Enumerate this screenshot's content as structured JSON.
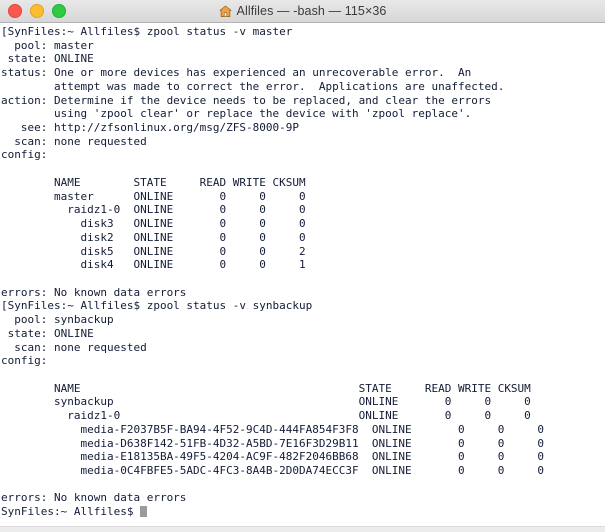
{
  "window": {
    "title": "Allfiles — -bash — 115×36",
    "title_icon": "home-icon",
    "traffic_lights": {
      "close_label": "close",
      "minimize_label": "minimize",
      "maximize_label": "maximize",
      "close_color": "#f9584f",
      "minimize_color": "#fdbc2d",
      "maximize_color": "#2ecb43"
    },
    "colors": {
      "terminal_background": "#ffffff",
      "terminal_text": "#131c37",
      "titlebar_background": "#e0dfdf",
      "cursor": "#9b9b9b"
    }
  },
  "terminal": {
    "columns": 115,
    "rows": 36,
    "prompt": "SynFiles:~ Allfiles$",
    "cursor_visible": true,
    "content": "[SynFiles:~ Allfiles$ zpool status -v master\n  pool: master\n state: ONLINE\nstatus: One or more devices has experienced an unrecoverable error.  An\n        attempt was made to correct the error.  Applications are unaffected.\naction: Determine if the device needs to be replaced, and clear the errors\n        using 'zpool clear' or replace the device with 'zpool replace'.\n   see: http://zfsonlinux.org/msg/ZFS-8000-9P\n  scan: none requested\nconfig:\n\n        NAME        STATE     READ WRITE CKSUM\n        master      ONLINE       0     0     0\n          raidz1-0  ONLINE       0     0     0\n            disk3   ONLINE       0     0     0\n            disk2   ONLINE       0     0     0\n            disk5   ONLINE       0     0     2\n            disk4   ONLINE       0     0     1\n\nerrors: No known data errors\n[SynFiles:~ Allfiles$ zpool status -v synbackup\n  pool: synbackup\n state: ONLINE\n  scan: none requested\nconfig:\n\n        NAME                                          STATE     READ WRITE CKSUM\n        synbackup                                     ONLINE       0     0     0\n          raidz1-0                                    ONLINE       0     0     0\n            media-F2037B5F-BA94-4F52-9C4D-444FA854F3F8  ONLINE       0     0     0\n            media-D638F142-51FB-4D32-A5BD-7E16F3D29B11  ONLINE       0     0     0\n            media-E18135BA-49F5-4204-AC9F-482F2046BB68  ONLINE       0     0     0\n            media-0C4FBFE5-5ADC-4FC3-8A4B-2D0DA74ECC3F  ONLINE       0     0     0\n\nerrors: No known data errors\n",
    "last_line": "SynFiles:~ Allfiles$ ",
    "commands": [
      "zpool status -v master",
      "zpool status -v synbackup"
    ],
    "pools": [
      {
        "pool": "master",
        "state": "ONLINE",
        "status": "One or more devices has experienced an unrecoverable error.  An attempt was made to correct the error.  Applications are unaffected.",
        "action": "Determine if the device needs to be replaced, and clear the errors using 'zpool clear' or replace the device with 'zpool replace'.",
        "see": "http://zfsonlinux.org/msg/ZFS-8000-9P",
        "scan": "none requested",
        "errors": "No known data errors",
        "columns": [
          "NAME",
          "STATE",
          "READ",
          "WRITE",
          "CKSUM"
        ],
        "rows": [
          {
            "name": "master",
            "indent": 0,
            "state": "ONLINE",
            "read": "0",
            "write": "0",
            "cksum": "0"
          },
          {
            "name": "raidz1-0",
            "indent": 1,
            "state": "ONLINE",
            "read": "0",
            "write": "0",
            "cksum": "0"
          },
          {
            "name": "disk3",
            "indent": 2,
            "state": "ONLINE",
            "read": "0",
            "write": "0",
            "cksum": "0"
          },
          {
            "name": "disk2",
            "indent": 2,
            "state": "ONLINE",
            "read": "0",
            "write": "0",
            "cksum": "0"
          },
          {
            "name": "disk5",
            "indent": 2,
            "state": "ONLINE",
            "read": "0",
            "write": "0",
            "cksum": "2"
          },
          {
            "name": "disk4",
            "indent": 2,
            "state": "ONLINE",
            "read": "0",
            "write": "0",
            "cksum": "1"
          }
        ]
      },
      {
        "pool": "synbackup",
        "state": "ONLINE",
        "scan": "none requested",
        "errors": "No known data errors",
        "columns": [
          "NAME",
          "STATE",
          "READ",
          "WRITE",
          "CKSUM"
        ],
        "rows": [
          {
            "name": "synbackup",
            "indent": 0,
            "state": "ONLINE",
            "read": "0",
            "write": "0",
            "cksum": "0"
          },
          {
            "name": "raidz1-0",
            "indent": 1,
            "state": "ONLINE",
            "read": "0",
            "write": "0",
            "cksum": "0"
          },
          {
            "name": "media-F2037B5F-BA94-4F52-9C4D-444FA854F3F8",
            "indent": 2,
            "state": "ONLINE",
            "read": "0",
            "write": "0",
            "cksum": "0"
          },
          {
            "name": "media-D638F142-51FB-4D32-A5BD-7E16F3D29B11",
            "indent": 2,
            "state": "ONLINE",
            "read": "0",
            "write": "0",
            "cksum": "0"
          },
          {
            "name": "media-E18135BA-49F5-4204-AC9F-482F2046BB68",
            "indent": 2,
            "state": "ONLINE",
            "read": "0",
            "write": "0",
            "cksum": "0"
          },
          {
            "name": "media-0C4FBFE5-5ADC-4FC3-8A4B-2D0DA74ECC3F",
            "indent": 2,
            "state": "ONLINE",
            "read": "0",
            "write": "0",
            "cksum": "0"
          }
        ]
      }
    ]
  }
}
